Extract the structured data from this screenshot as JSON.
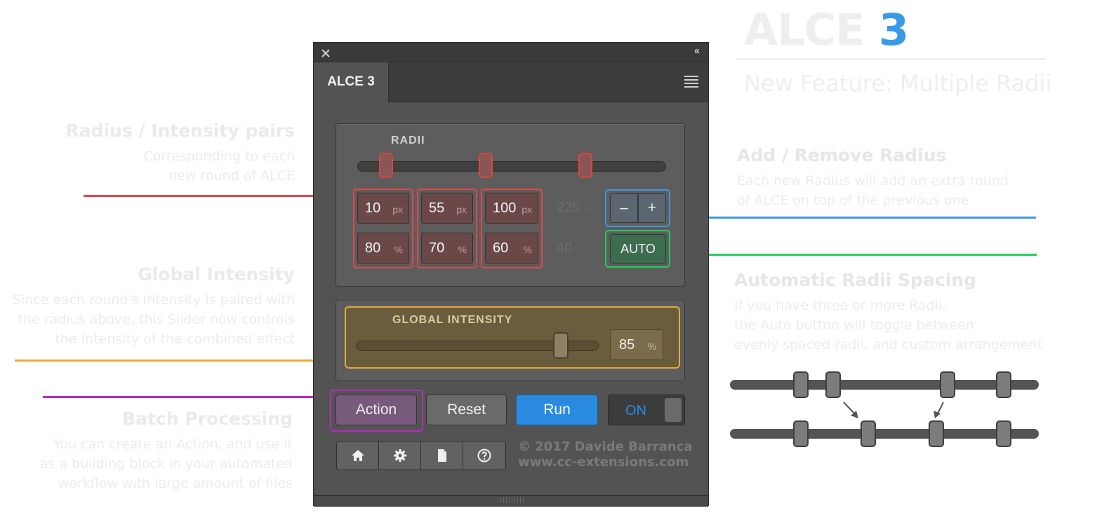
{
  "header": {
    "brand_text": "ALCE",
    "brand_num": "3",
    "subtitle": "New Feature: Multiple Radii"
  },
  "left_notes": [
    {
      "title": "Radius / Intensity pairs",
      "lines": [
        "Corresponding to each",
        "new round of ALCE"
      ],
      "color": "#e8454e"
    },
    {
      "title": "Global Intensity",
      "lines": [
        "Since each round's Intensity is paired with",
        "the radius above, this Slider now controls",
        "the Intensity of the combined effect"
      ],
      "color": "#e8a83c"
    },
    {
      "title": "Batch Processing",
      "lines": [
        "You can create an Action, and use it",
        "as a building block in your automated",
        "workflow with large amount of files"
      ],
      "color": "#b82cc2"
    }
  ],
  "right_notes": [
    {
      "title": "Add / Remove Radius",
      "lines": [
        "Each new Radius will add an extra round",
        "of ALCE on top of the previous one"
      ],
      "color": "#3b97e0"
    },
    {
      "title": "Automatic Radii Spacing",
      "lines": [
        "If you have three or more Radii,",
        "the Auto button will toggle between",
        "evenly spaced radii, and custom arrangement"
      ],
      "color": "#1ecf5a"
    }
  ],
  "panel": {
    "close_icon": "close-icon",
    "collapse_label": "‹‹",
    "tab_title": "ALCE 3",
    "radii": {
      "label": "RADII",
      "pairs": [
        {
          "radius": "10",
          "radius_unit": "px",
          "intensity": "80",
          "intensity_unit": "%"
        },
        {
          "radius": "55",
          "radius_unit": "px",
          "intensity": "70",
          "intensity_unit": "%"
        },
        {
          "radius": "100",
          "radius_unit": "px",
          "intensity": "60",
          "intensity_unit": "%"
        }
      ],
      "ghost": {
        "radius": "225",
        "radius_unit": "px",
        "intensity": "40",
        "intensity_unit": "%"
      },
      "minus_label": "–",
      "plus_label": "+",
      "auto_label": "AUTO"
    },
    "global_intensity": {
      "label": "GLOBAL INTENSITY",
      "value": "85",
      "unit": "%",
      "level_fraction": 0.85
    },
    "buttons": {
      "action": "Action",
      "reset": "Reset",
      "run": "Run",
      "toggle": "ON"
    },
    "footer": {
      "icons": [
        "home-icon",
        "gear-icon",
        "document-icon",
        "help-icon"
      ],
      "copyright": "© 2017 Davide Barranca",
      "website": "www.cc-extensions.com"
    }
  },
  "colors": {
    "red": "#e8454e",
    "blue": "#3b97e0",
    "green": "#1ecf5a",
    "orange": "#e8a83c",
    "purple": "#b82cc2",
    "run_blue": "#2a8ae0"
  }
}
